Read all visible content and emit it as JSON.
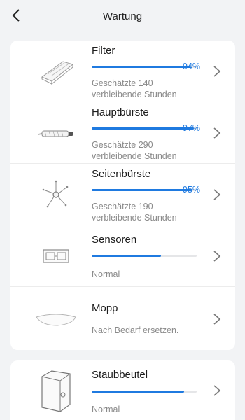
{
  "header": {
    "title": "Wartung"
  },
  "items": [
    {
      "name": "Filter",
      "progress": 0.94,
      "percent": "94%",
      "line1": "Geschätzte 140",
      "line2": "verbleibende Stunden",
      "icon": "filter-icon"
    },
    {
      "name": "Hauptbürste",
      "progress": 0.97,
      "percent": "97%",
      "line1": "Geschätzte 290",
      "line2": "verbleibende Stunden",
      "icon": "main-brush-icon"
    },
    {
      "name": "Seitenbürste",
      "progress": 0.95,
      "percent": "95%",
      "line1": "Geschätzte 190",
      "line2": "verbleibende Stunden",
      "icon": "side-brush-icon"
    },
    {
      "name": "Sensoren",
      "progress": 0.66,
      "status": "Normal",
      "icon": "sensor-icon"
    },
    {
      "name": "Mopp",
      "status": "Nach Bedarf ersetzen.",
      "icon": "mop-icon"
    }
  ],
  "dustbag": {
    "name": "Staubbeutel",
    "progress": 0.88,
    "status": "Normal",
    "icon": "dustbag-icon"
  },
  "colors": {
    "accent": "#1f7ae0",
    "track": "#e5e6e8",
    "background": "#f2f3f5"
  }
}
